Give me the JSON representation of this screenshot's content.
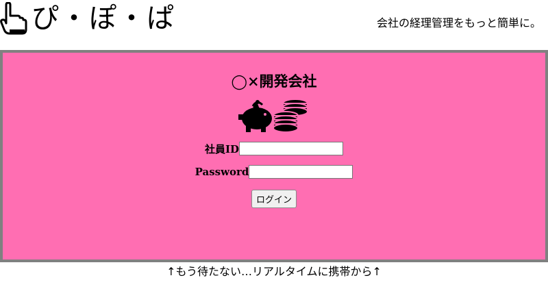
{
  "header": {
    "logo_icon": "pointing-hand-icon",
    "logo_text": "ぴ・ぽ・ぱ",
    "tagline": "会社の経理管理をもっと簡単に。"
  },
  "login": {
    "company_name": "◯×開発会社",
    "illustration_icon": "piggy-bank-coins-icon",
    "employee_id_label": "社員ID",
    "employee_id_value": "",
    "password_label": "Password",
    "password_value": "",
    "login_button": "ログイン"
  },
  "footer": {
    "text": "↑もう待たない…リアルタイムに携帯から↑"
  },
  "colors": {
    "panel_background": "#ff6eb2",
    "panel_border": "#808080"
  }
}
